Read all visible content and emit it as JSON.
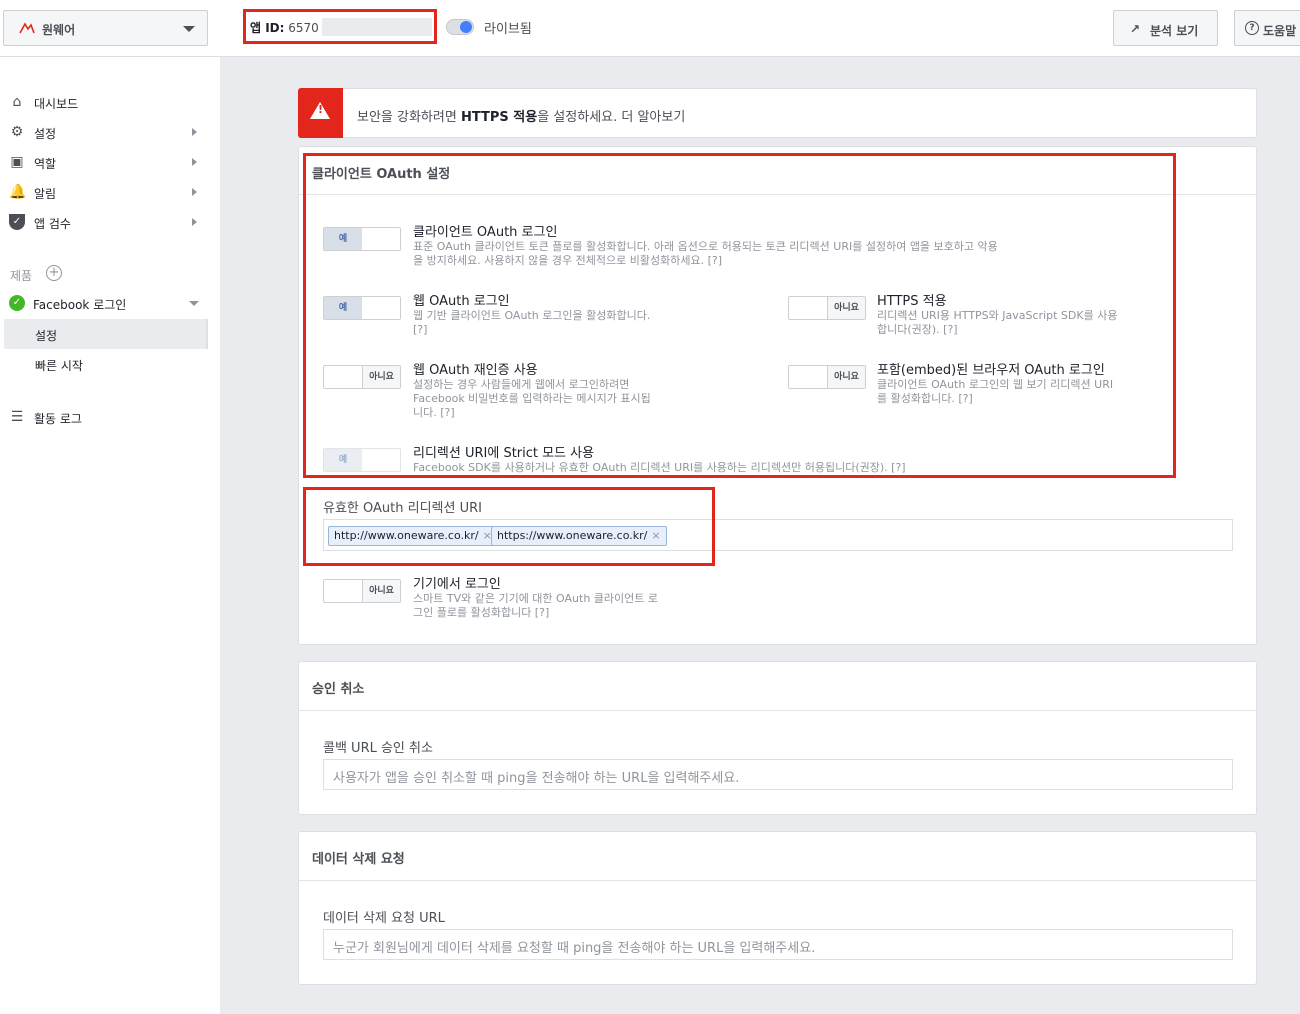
{
  "header": {
    "app_name": "원웨어",
    "app_id_label": "앱 ID:",
    "app_id_value": "6570",
    "live_label": "라이브됨",
    "analytics_button": "분석 보기",
    "help_button": "도움말"
  },
  "sidebar": {
    "items": [
      {
        "label": "대시보드",
        "icon": "home-icon"
      },
      {
        "label": "설정",
        "icon": "gear-icon"
      },
      {
        "label": "역할",
        "icon": "roles-icon"
      },
      {
        "label": "알림",
        "icon": "bell-icon"
      },
      {
        "label": "앱 검수",
        "icon": "shield-check-icon"
      }
    ],
    "products_label": "제품",
    "product_name": "Facebook 로그인",
    "product_sub": [
      "설정",
      "빠른 시작"
    ],
    "activity_log": "활동 로그"
  },
  "alert": {
    "text_pre": "보안을 강화하려면 ",
    "text_bold": "HTTPS 적용",
    "text_post": "을 설정하세요. 더 알아보기"
  },
  "oauth": {
    "title": "클라이언트 OAuth 설정",
    "options": [
      {
        "title": "클라이언트 OAuth 로그인",
        "desc": "표준 OAuth 클라이언트 토큰 플로를 활성화합니다. 아래 옵션으로 허용되는 토큰 리디렉션 URI를 설정하여 앱을 보호하고 악용을 방지하세요. 사용하지 않을 경우 전체적으로 비활성화하세요. [?]",
        "state": "예"
      },
      {
        "title": "웹 OAuth 로그인",
        "desc": "웹 기반 클라이언트 OAuth 로그인을 활성화합니다. [?]",
        "state": "예"
      },
      {
        "title": "HTTPS 적용",
        "desc": "리디렉션 URI용 HTTPS와 JavaScript SDK를 사용합니다(권장). [?]",
        "state": "아니요"
      },
      {
        "title": "웹 OAuth 재인증 사용",
        "desc": "설정하는 경우 사람들에게 웹에서 로그인하려면 Facebook 비밀번호를 입력하라는 메시지가 표시됩니다. [?]",
        "state": "아니요"
      },
      {
        "title": "포함(embed)된 브라우저 OAuth 로그인",
        "desc": "클라이언트 OAuth 로그인의 웹 보기 리디렉션 URI를 활성화합니다. [?]",
        "state": "아니요"
      },
      {
        "title": "리디렉션 URI에 Strict 모드 사용",
        "desc": "Facebook SDK를 사용하거나 유효한 OAuth 리디렉션 URI를 사용하는 리디렉션만 허용됩니다(권장). [?]",
        "state": "예"
      }
    ],
    "valid_uri_label": "유효한 OAuth 리디렉션 URI",
    "uris": [
      "http://www.oneware.co.kr/",
      "https://www.oneware.co.kr/"
    ],
    "device_login": {
      "title": "기기에서 로그인",
      "desc": "스마트 TV와 같은 기기에 대한 OAuth 클라이언트 로그인 플로를 활성화합니다 [?]",
      "state": "아니요"
    }
  },
  "deauth": {
    "title": "승인 취소",
    "label": "콜백 URL 승인 취소",
    "placeholder": "사용자가 앱을 승인 취소할 때 ping을 전송해야 하는 URL을 입력해주세요."
  },
  "data_deletion": {
    "title": "데이터 삭제 요청",
    "label": "데이터 삭제 요청 URL",
    "placeholder": "누군가 회원님에게 데이터 삭제를 요청할 때 ping을 전송해야 하는 URL을 입력해주세요."
  },
  "colors": {
    "accent": "#4080ff",
    "alert_red": "#e3261b",
    "success_green": "#42b72a"
  }
}
